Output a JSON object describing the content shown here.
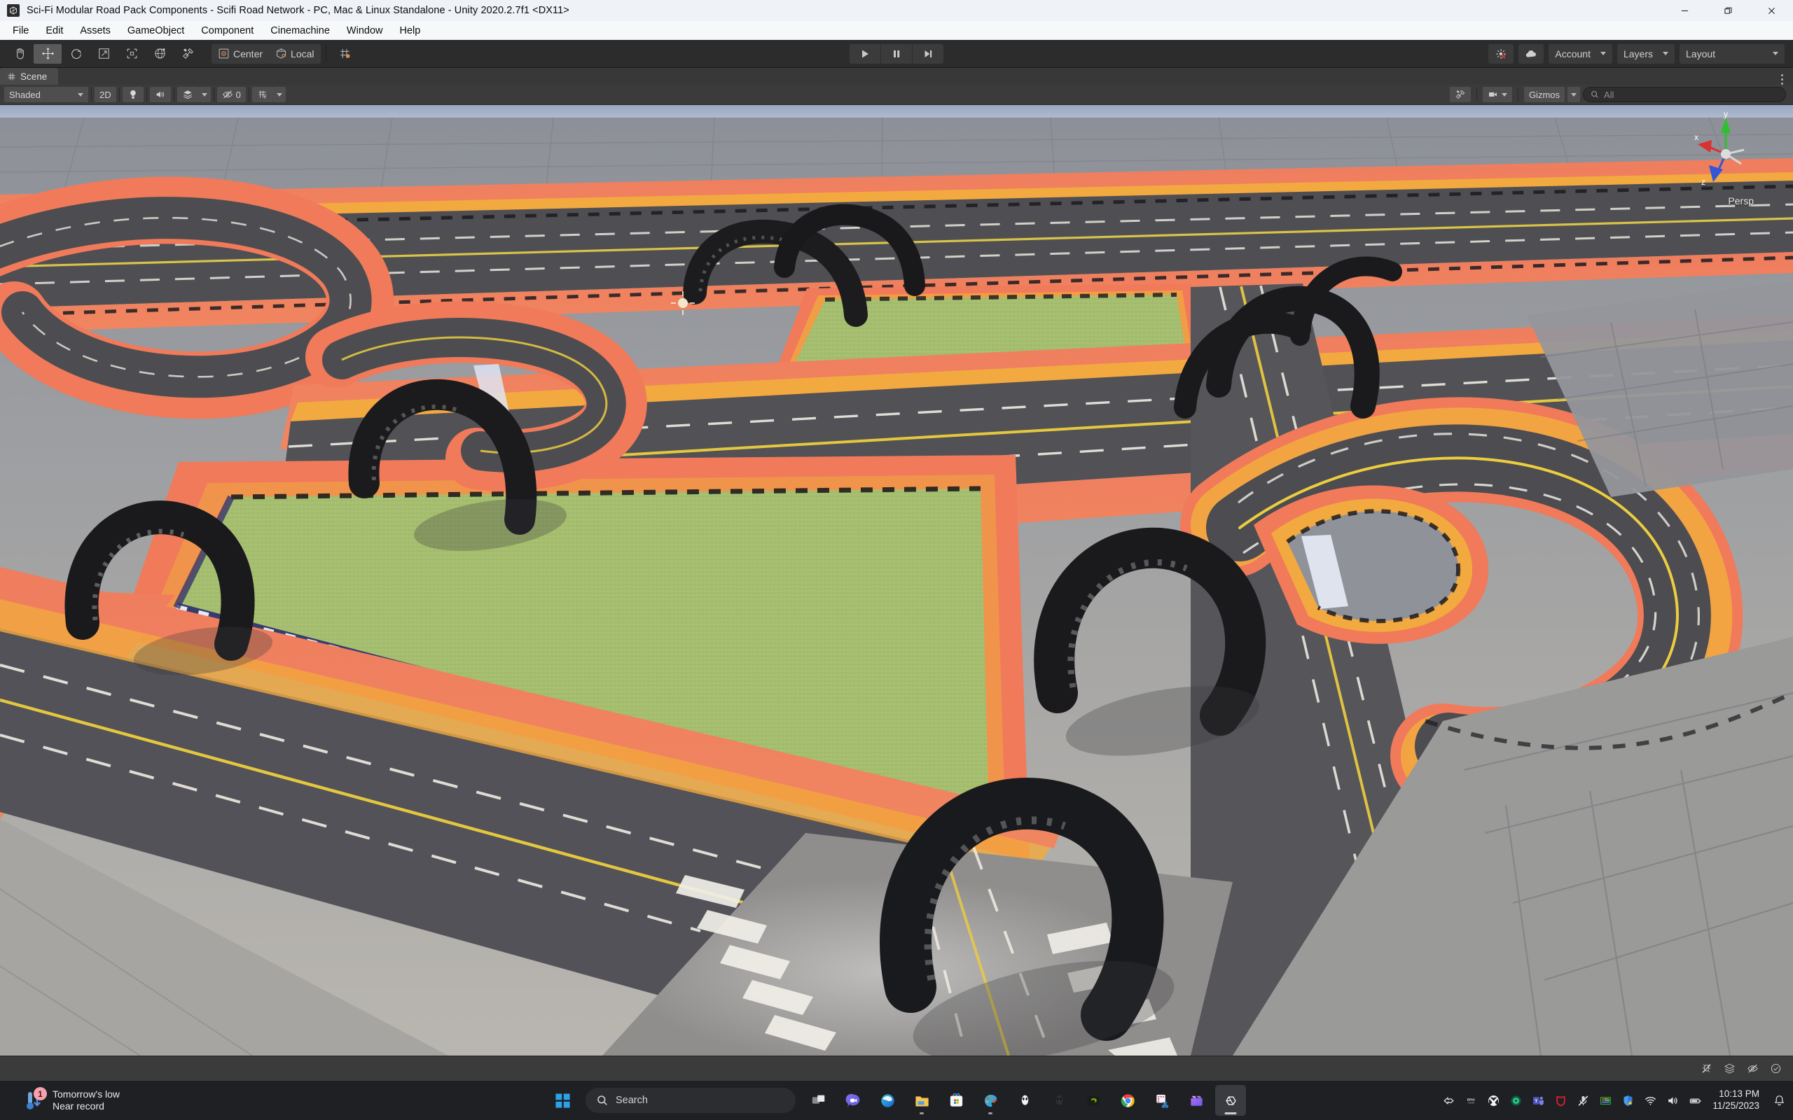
{
  "window": {
    "title": "Sci-Fi Modular Road Pack Components - Scifi Road Network - PC, Mac & Linux Standalone - Unity 2020.2.7f1 <DX11>",
    "app_icon": "unity-icon",
    "minimize_label": "Minimize",
    "restore_label": "Restore",
    "close_label": "Close"
  },
  "menubar": {
    "items": [
      {
        "label": "File"
      },
      {
        "label": "Edit"
      },
      {
        "label": "Assets"
      },
      {
        "label": "GameObject"
      },
      {
        "label": "Component"
      },
      {
        "label": "Cinemachine"
      },
      {
        "label": "Window"
      },
      {
        "label": "Help"
      }
    ]
  },
  "toolbar": {
    "tools": [
      {
        "name": "hand-tool",
        "tooltip": "Hand Tool",
        "active": false
      },
      {
        "name": "move-tool",
        "tooltip": "Move Tool",
        "active": true
      },
      {
        "name": "rotate-tool",
        "tooltip": "Rotate Tool",
        "active": false
      },
      {
        "name": "scale-tool",
        "tooltip": "Scale Tool",
        "active": false
      },
      {
        "name": "rect-tool",
        "tooltip": "Rect Transform Tool",
        "active": false
      },
      {
        "name": "transform-tool",
        "tooltip": "Move Rotate or Scale",
        "active": false
      },
      {
        "name": "custom-editor-tool",
        "tooltip": "Custom Editor Tool",
        "active": false
      }
    ],
    "pivot_label": "Center",
    "rotation_label": "Local",
    "grid_snap_tooltip": "Grid Snapping",
    "play_label": "Play",
    "pause_label": "Pause",
    "step_label": "Step",
    "collab_label": "Collab",
    "cloud_label": "Services",
    "account_label": "Account",
    "layers_label": "Layers",
    "layout_label": "Layout"
  },
  "scene_panel": {
    "tab_label": "Scene",
    "draw_mode": "Shaded",
    "two_d_label": "2D",
    "lighting_tooltip": "Toggle Scene Lighting",
    "audio_tooltip": "Toggle Scene Audio",
    "effects_tooltip": "Toggle Skybox, Fog and other Effects",
    "hidden_objects_count": "0",
    "grid_tooltip": "Toggle Grid Visibility",
    "tools_tooltip": "Scene View Tools",
    "camera_tooltip": "Scene Camera Settings",
    "gizmos_label": "Gizmos",
    "gizmos_search_placeholder": "All",
    "gizmos_search_value": ""
  },
  "viewport": {
    "projection_label": "Persp",
    "axis_x": "x",
    "axis_y": "y",
    "axis_z": "z",
    "colors": {
      "axis_x": "#d93232",
      "axis_y": "#2fbf2f",
      "axis_z": "#3356d6",
      "ground": "#8e9197",
      "asphalt": "#4a4a4d",
      "curb_orange": "#f07a5a",
      "curb_yellow": "#f5a73c",
      "grass": "#a4bd6e",
      "lane_white": "#f2f2f2",
      "lane_yellow": "#f2d23c",
      "sky": "#b9c3d6"
    }
  },
  "statusbar": {
    "icons": [
      {
        "name": "debug-icon"
      },
      {
        "name": "layers-stack-icon"
      },
      {
        "name": "eye-off-icon"
      },
      {
        "name": "check-circle-icon"
      }
    ]
  },
  "taskbar": {
    "weather": {
      "badge_count": "1",
      "line1": "Tomorrow's low",
      "line2": "Near record"
    },
    "start_label": "Start",
    "search": {
      "placeholder": "Search",
      "value": ""
    },
    "apps": [
      {
        "name": "task-view-icon",
        "label": "Task View",
        "active": false,
        "running": false
      },
      {
        "name": "chat-icon",
        "label": "Chat",
        "active": false,
        "running": false
      },
      {
        "name": "edge-icon",
        "label": "Microsoft Edge",
        "active": false,
        "running": false
      },
      {
        "name": "file-explorer-icon",
        "label": "File Explorer",
        "active": false,
        "running": true
      },
      {
        "name": "microsoft-store-icon",
        "label": "Microsoft Store",
        "active": false,
        "running": false
      },
      {
        "name": "paint-icon",
        "label": "Paint",
        "active": false,
        "running": true
      },
      {
        "name": "alienware-light-icon",
        "label": "Alienware Command Center",
        "active": false,
        "running": false
      },
      {
        "name": "alienware-dark-icon",
        "label": "Alienware",
        "active": false,
        "running": false
      },
      {
        "name": "nvidia-icon",
        "label": "NVIDIA",
        "active": false,
        "running": false
      },
      {
        "name": "chrome-icon",
        "label": "Google Chrome",
        "active": false,
        "running": false
      },
      {
        "name": "snipping-tool-icon",
        "label": "Snipping Tool",
        "active": false,
        "running": false
      },
      {
        "name": "clipchamp-icon",
        "label": "Clipchamp",
        "active": false,
        "running": false
      },
      {
        "name": "unity-icon",
        "label": "Unity",
        "active": true,
        "running": true
      }
    ],
    "tray": [
      {
        "name": "unity-hub-icon",
        "label": "Unity Hub"
      },
      {
        "name": "epic-games-icon",
        "label": "Epic Games Launcher"
      },
      {
        "name": "xbox-icon",
        "label": "Xbox"
      },
      {
        "name": "green-orb-icon",
        "label": "App"
      },
      {
        "name": "teams-icon",
        "label": "Microsoft Teams"
      },
      {
        "name": "mcafee-icon",
        "label": "McAfee"
      },
      {
        "name": "mic-muted-icon",
        "label": "Microphone muted"
      },
      {
        "name": "rgb-keyboard-icon",
        "label": "RGB Lighting"
      },
      {
        "name": "defender-warning-icon",
        "label": "Windows Security"
      },
      {
        "name": "wifi-icon",
        "label": "Network"
      },
      {
        "name": "volume-icon",
        "label": "Volume"
      },
      {
        "name": "battery-icon",
        "label": "Battery"
      }
    ],
    "clock": {
      "time": "10:13 PM",
      "date": "11/25/2023"
    },
    "notifications_label": "Notifications"
  }
}
